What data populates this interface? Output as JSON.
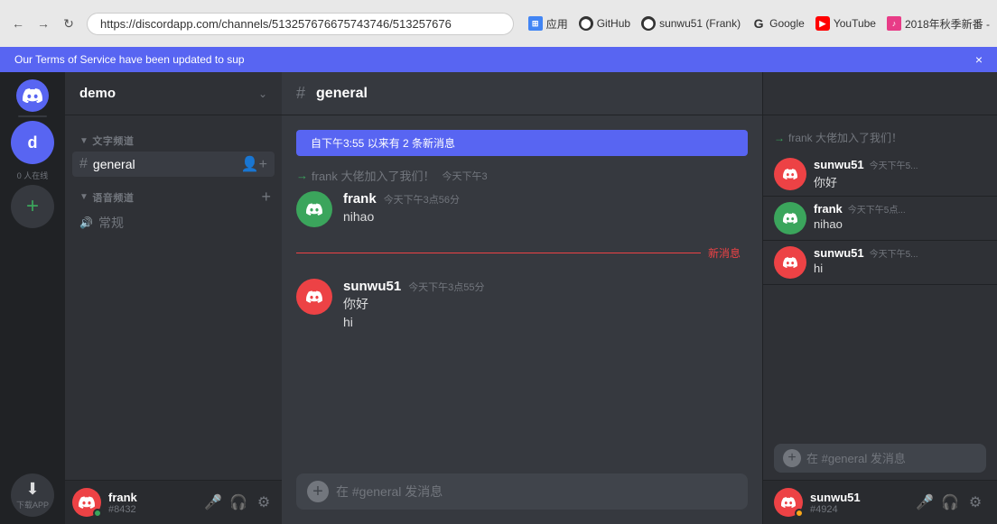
{
  "browser": {
    "url": "https://discordapp.com/channels/513257676675743746/513257676",
    "bookmarks": [
      {
        "label": "应用",
        "icon": "apps",
        "color": "#4285f4"
      },
      {
        "label": "GitHub",
        "icon": "github",
        "color": "#333"
      },
      {
        "label": "sunwu51 (Frank)",
        "icon": "github2",
        "color": "#333"
      },
      {
        "label": "Google",
        "icon": "google",
        "color": "#4285f4"
      },
      {
        "label": "YouTube",
        "icon": "youtube",
        "color": "#ff0000"
      },
      {
        "label": "2018年秋季新番 -",
        "icon": "2018",
        "color": "#e83c87"
      }
    ]
  },
  "notification": {
    "text": "Our Terms of Service have been updated to sup",
    "close": "×"
  },
  "server": {
    "name": "demo",
    "text_category": "文字频道",
    "voice_category": "语音频道",
    "channels": [
      {
        "name": "general",
        "type": "text",
        "active": true
      }
    ],
    "voice_channels": [
      {
        "name": "常规",
        "type": "voice"
      }
    ]
  },
  "sidebar": {
    "online_count": "0 人在线",
    "download_label": "下\n载APP"
  },
  "chat": {
    "channel_name": "general",
    "new_messages_bar": "自下午3:55 以来有 2 条新消息",
    "messages": [
      {
        "type": "system",
        "text": "frank 大佬加入了我们！",
        "timestamp": "今天下午3"
      },
      {
        "type": "message",
        "avatar_color": "green",
        "username": "frank",
        "timestamp": "今天下午3点56分",
        "text": "nihao",
        "avatar_letter": "D"
      },
      {
        "type": "divider",
        "label": "新消息"
      },
      {
        "type": "message",
        "avatar_color": "red",
        "username": "sunwu51",
        "timestamp": "今天下午3点55分",
        "text1": "你好",
        "text2": "hi",
        "avatar_letter": "D"
      }
    ],
    "input_placeholder": "在 #general 发消息"
  },
  "right_panel": {
    "messages": [
      {
        "type": "system",
        "text": "frank 大佬加入了我们！"
      },
      {
        "type": "message",
        "avatar_color": "red",
        "username": "sunwu51",
        "timestamp": "今天下午5...",
        "text": "你好",
        "avatar_letter": "D"
      },
      {
        "type": "message",
        "avatar_color": "green",
        "username": "frank",
        "timestamp": "今天下午5点...",
        "text": "nihao",
        "avatar_letter": "D"
      },
      {
        "type": "message",
        "avatar_color": "red",
        "username": "sunwu51",
        "timestamp": "今天下午5...",
        "text": "hi",
        "avatar_letter": "D"
      }
    ],
    "input_placeholder": "在 #general 发消息"
  },
  "user": {
    "name": "frank",
    "tag": "#8432",
    "avatar_letter": "D",
    "avatar_color": "#ed4245"
  },
  "right_user": {
    "name": "sunwu51",
    "tag": "#4924",
    "avatar_letter": "D",
    "avatar_color": "#ed4245"
  }
}
